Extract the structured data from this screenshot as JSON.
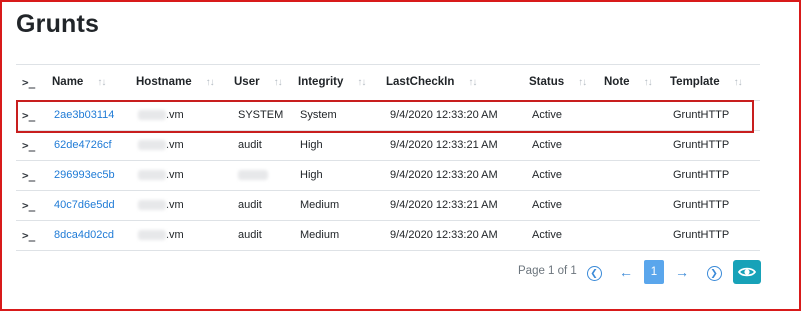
{
  "page": {
    "title": "Grunts"
  },
  "table": {
    "terminal_glyph": ">_",
    "sort_glyph": "↑↓",
    "columns": {
      "name": "Name",
      "hostname": "Hostname",
      "user": "User",
      "integrity": "Integrity",
      "lastcheckin": "LastCheckIn",
      "status": "Status",
      "note": "Note",
      "template": "Template"
    },
    "rows": [
      {
        "name": "2ae3b03114",
        "hostname_suffix": ".vm",
        "user": "SYSTEM",
        "integrity": "System",
        "lastcheckin": "9/4/2020 12:33:20 AM",
        "status": "Active",
        "note": "",
        "template": "GruntHTTP"
      },
      {
        "name": "62de4726cf",
        "hostname_suffix": ".vm",
        "user": "audit",
        "integrity": "High",
        "lastcheckin": "9/4/2020 12:33:21 AM",
        "status": "Active",
        "note": "",
        "template": "GruntHTTP"
      },
      {
        "name": "296993ec5b",
        "hostname_suffix": ".vm",
        "user": "",
        "integrity": "High",
        "lastcheckin": "9/4/2020 12:33:20 AM",
        "status": "Active",
        "note": "",
        "template": "GruntHTTP"
      },
      {
        "name": "40c7d6e5dd",
        "hostname_suffix": ".vm",
        "user": "audit",
        "integrity": "Medium",
        "lastcheckin": "9/4/2020 12:33:21 AM",
        "status": "Active",
        "note": "",
        "template": "GruntHTTP"
      },
      {
        "name": "8dca4d02cd",
        "hostname_suffix": ".vm",
        "user": "audit",
        "integrity": "Medium",
        "lastcheckin": "9/4/2020 12:33:20 AM",
        "status": "Active",
        "note": "",
        "template": "GruntHTTP"
      }
    ]
  },
  "pagination": {
    "info": "Page 1 of 1",
    "current_page": "1",
    "first_icon": "first-page-icon",
    "prev_icon": "arrow-left-icon",
    "next_icon": "arrow-right-icon",
    "last_icon": "last-page-icon",
    "view_icon": "eye-icon"
  },
  "colors": {
    "accent": "#1f7bd6",
    "highlight_border": "#c81e1e",
    "frame_border": "#d81a1a",
    "view_button": "#17a2b8",
    "current_page_bg": "#5aa6ec"
  }
}
